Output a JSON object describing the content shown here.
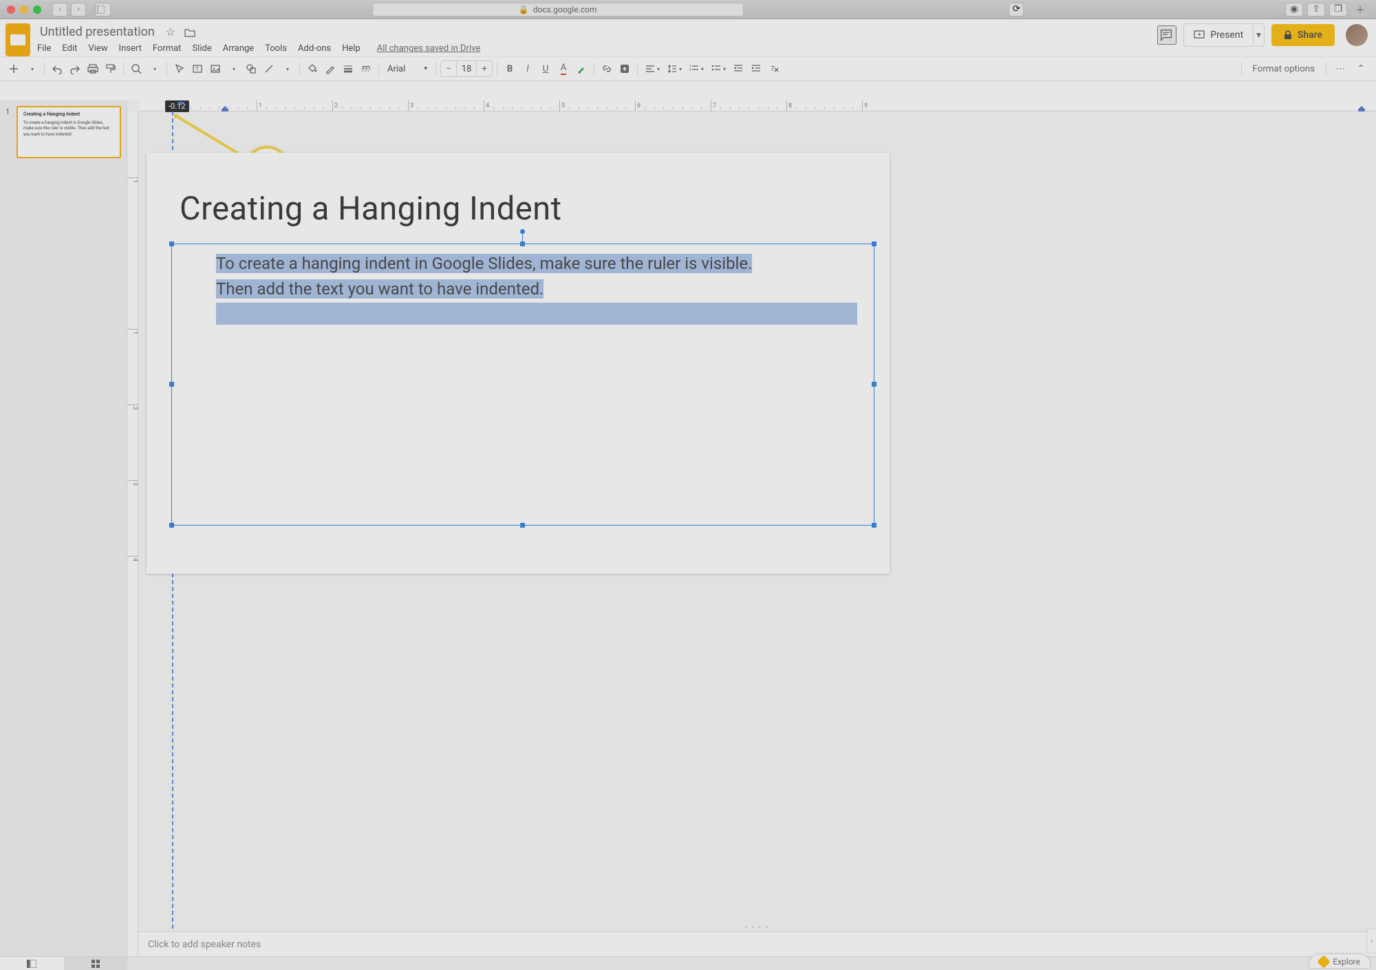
{
  "browser": {
    "url": "docs.google.com"
  },
  "doc": {
    "title": "Untitled presentation",
    "save_status": "All changes saved in Drive"
  },
  "menus": [
    "File",
    "Edit",
    "View",
    "Insert",
    "Format",
    "Slide",
    "Arrange",
    "Tools",
    "Add-ons",
    "Help"
  ],
  "header": {
    "present": "Present",
    "share": "Share"
  },
  "toolbar": {
    "font": "Arial",
    "font_size": "18",
    "format_options": "Format options"
  },
  "ruler": {
    "tooltip": "-0.12",
    "h_ticks": [
      "1",
      "2",
      "3",
      "4",
      "5",
      "6",
      "7",
      "8",
      "9"
    ],
    "v_ticks": [
      "1",
      "1",
      "2",
      "3",
      "4"
    ]
  },
  "callout": {
    "value": "-0.12"
  },
  "slide": {
    "title": "Creating a Hanging Indent",
    "body_line1": "To  create a hanging indent in Google Slides, make sure the ruler is visible.",
    "body_line2": "Then add the text you want to have indented."
  },
  "thumb": {
    "num": "1",
    "title": "Creating a Hanging Indent",
    "body": "To create a hanging indent in Google Slides, make sure the ruler is visible. Then add the text you want to have indented."
  },
  "notes": {
    "placeholder": "Click to add speaker notes"
  },
  "explore": {
    "label": "Explore"
  }
}
